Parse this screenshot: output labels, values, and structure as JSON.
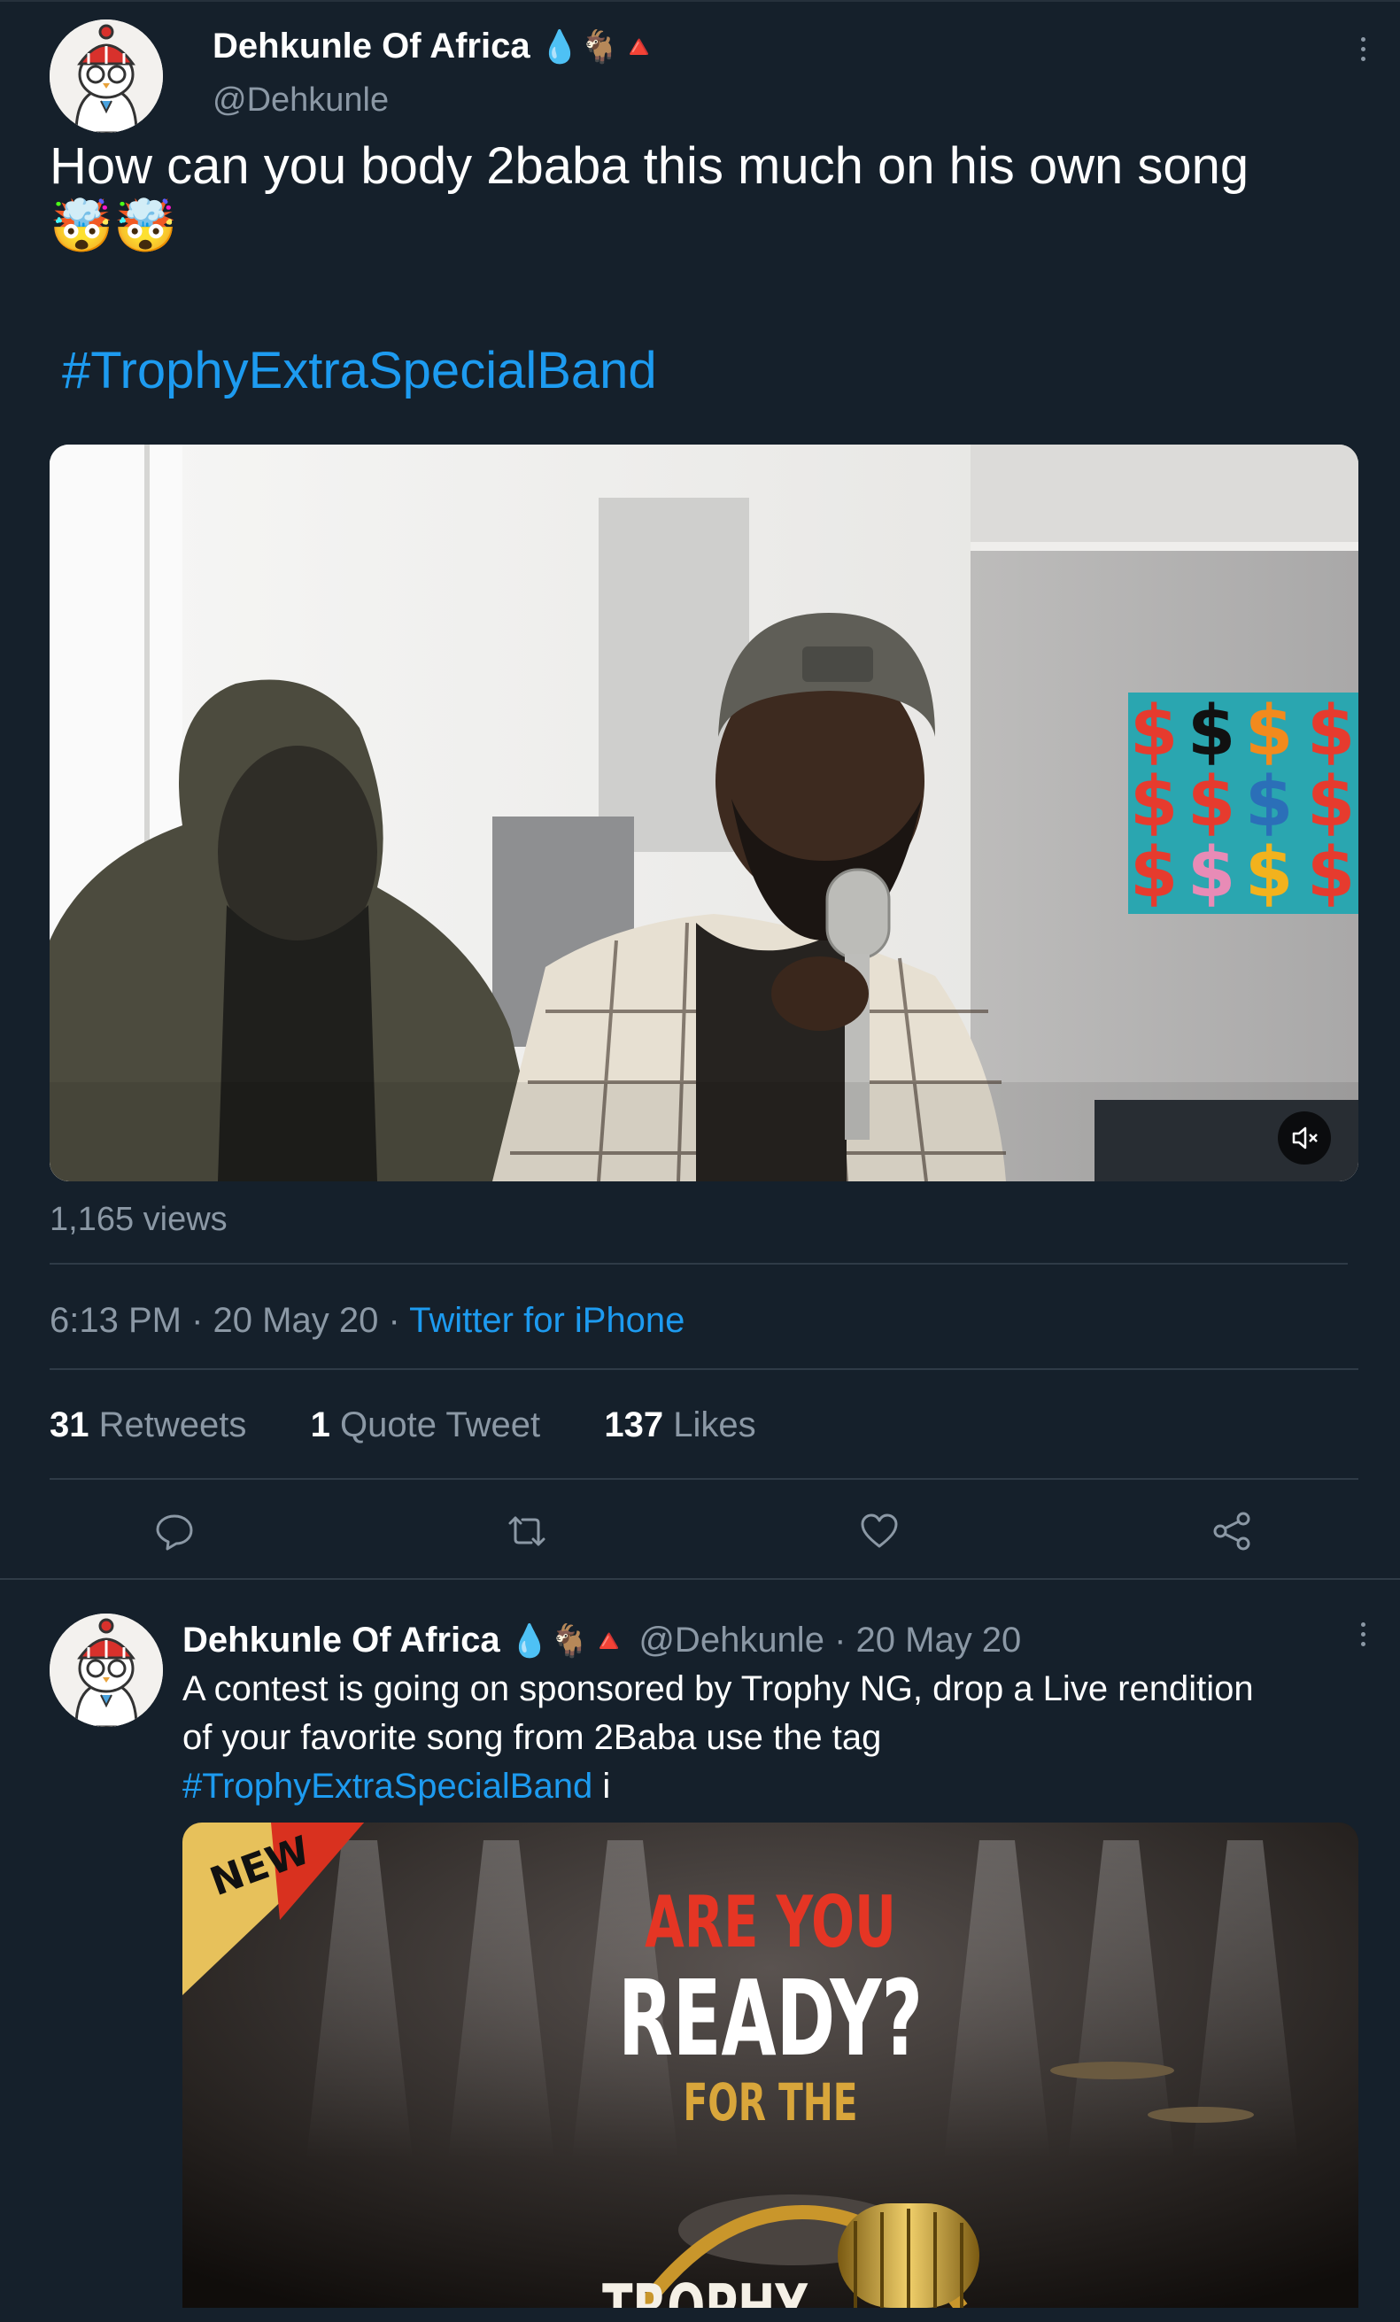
{
  "main_tweet": {
    "author_name": "Dehkunle Of Africa",
    "author_badges": "💧🐐🔺",
    "handle": "@Dehkunle",
    "text": "How can you body 2baba this much on his own song",
    "emoji": "🤯🤯",
    "hashtag": "#TrophyExtraSpecialBand",
    "views": "1,165 views",
    "time": "6:13 PM",
    "date": "20 May 20",
    "separator": "·",
    "source": "Twitter for iPhone",
    "stats": {
      "retweets_count": "31",
      "retweets_label": "Retweets",
      "quotes_count": "1",
      "quotes_label": "Quote Tweet",
      "likes_count": "137",
      "likes_label": "Likes"
    }
  },
  "quoted_tweet": {
    "author_name": "Dehkunle Of Africa",
    "author_badges": "💧🐐🔺",
    "handle": "@Dehkunle",
    "separator": "·",
    "date": "20 May 20",
    "text_line1": "A contest is going on sponsored by Trophy NG, drop a Live rendition",
    "text_line2": "of your favorite song from 2Baba use the tag",
    "hashtag": "#TrophyExtraSpecialBand",
    "text_suffix": "i",
    "image_text": {
      "corner": "NEW",
      "line1": "ARE YOU",
      "line2": "READY?",
      "line3": "FOR THE",
      "brand": "TROPHY"
    }
  },
  "icons": [
    "reply-icon",
    "retweet-icon",
    "like-icon",
    "share-icon",
    "mute-icon",
    "more-icon"
  ],
  "colors": {
    "background": "#15202b",
    "link": "#1d9bf0",
    "muted": "#8b98a5"
  }
}
